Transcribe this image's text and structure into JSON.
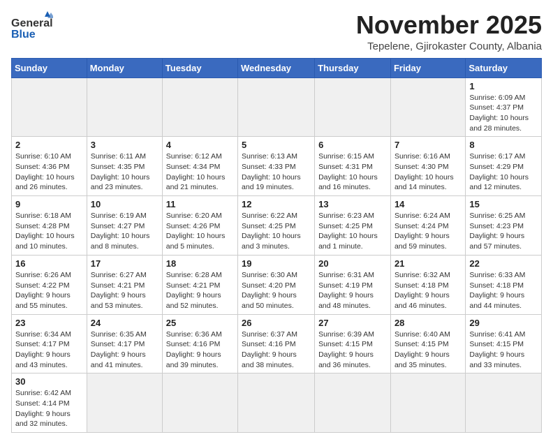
{
  "header": {
    "logo_general": "General",
    "logo_blue": "Blue",
    "title": "November 2025",
    "subtitle": "Tepelene, Gjirokaster County, Albania"
  },
  "days_of_week": [
    "Sunday",
    "Monday",
    "Tuesday",
    "Wednesday",
    "Thursday",
    "Friday",
    "Saturday"
  ],
  "weeks": [
    [
      {
        "day": "",
        "info": "",
        "empty": true
      },
      {
        "day": "",
        "info": "",
        "empty": true
      },
      {
        "day": "",
        "info": "",
        "empty": true
      },
      {
        "day": "",
        "info": "",
        "empty": true
      },
      {
        "day": "",
        "info": "",
        "empty": true
      },
      {
        "day": "",
        "info": "",
        "empty": true
      },
      {
        "day": "1",
        "info": "Sunrise: 6:09 AM\nSunset: 4:37 PM\nDaylight: 10 hours\nand 28 minutes."
      }
    ],
    [
      {
        "day": "2",
        "info": "Sunrise: 6:10 AM\nSunset: 4:36 PM\nDaylight: 10 hours\nand 26 minutes."
      },
      {
        "day": "3",
        "info": "Sunrise: 6:11 AM\nSunset: 4:35 PM\nDaylight: 10 hours\nand 23 minutes."
      },
      {
        "day": "4",
        "info": "Sunrise: 6:12 AM\nSunset: 4:34 PM\nDaylight: 10 hours\nand 21 minutes."
      },
      {
        "day": "5",
        "info": "Sunrise: 6:13 AM\nSunset: 4:33 PM\nDaylight: 10 hours\nand 19 minutes."
      },
      {
        "day": "6",
        "info": "Sunrise: 6:15 AM\nSunset: 4:31 PM\nDaylight: 10 hours\nand 16 minutes."
      },
      {
        "day": "7",
        "info": "Sunrise: 6:16 AM\nSunset: 4:30 PM\nDaylight: 10 hours\nand 14 minutes."
      },
      {
        "day": "8",
        "info": "Sunrise: 6:17 AM\nSunset: 4:29 PM\nDaylight: 10 hours\nand 12 minutes."
      }
    ],
    [
      {
        "day": "9",
        "info": "Sunrise: 6:18 AM\nSunset: 4:28 PM\nDaylight: 10 hours\nand 10 minutes."
      },
      {
        "day": "10",
        "info": "Sunrise: 6:19 AM\nSunset: 4:27 PM\nDaylight: 10 hours\nand 8 minutes."
      },
      {
        "day": "11",
        "info": "Sunrise: 6:20 AM\nSunset: 4:26 PM\nDaylight: 10 hours\nand 5 minutes."
      },
      {
        "day": "12",
        "info": "Sunrise: 6:22 AM\nSunset: 4:25 PM\nDaylight: 10 hours\nand 3 minutes."
      },
      {
        "day": "13",
        "info": "Sunrise: 6:23 AM\nSunset: 4:25 PM\nDaylight: 10 hours\nand 1 minute."
      },
      {
        "day": "14",
        "info": "Sunrise: 6:24 AM\nSunset: 4:24 PM\nDaylight: 9 hours\nand 59 minutes."
      },
      {
        "day": "15",
        "info": "Sunrise: 6:25 AM\nSunset: 4:23 PM\nDaylight: 9 hours\nand 57 minutes."
      }
    ],
    [
      {
        "day": "16",
        "info": "Sunrise: 6:26 AM\nSunset: 4:22 PM\nDaylight: 9 hours\nand 55 minutes."
      },
      {
        "day": "17",
        "info": "Sunrise: 6:27 AM\nSunset: 4:21 PM\nDaylight: 9 hours\nand 53 minutes."
      },
      {
        "day": "18",
        "info": "Sunrise: 6:28 AM\nSunset: 4:21 PM\nDaylight: 9 hours\nand 52 minutes."
      },
      {
        "day": "19",
        "info": "Sunrise: 6:30 AM\nSunset: 4:20 PM\nDaylight: 9 hours\nand 50 minutes."
      },
      {
        "day": "20",
        "info": "Sunrise: 6:31 AM\nSunset: 4:19 PM\nDaylight: 9 hours\nand 48 minutes."
      },
      {
        "day": "21",
        "info": "Sunrise: 6:32 AM\nSunset: 4:18 PM\nDaylight: 9 hours\nand 46 minutes."
      },
      {
        "day": "22",
        "info": "Sunrise: 6:33 AM\nSunset: 4:18 PM\nDaylight: 9 hours\nand 44 minutes."
      }
    ],
    [
      {
        "day": "23",
        "info": "Sunrise: 6:34 AM\nSunset: 4:17 PM\nDaylight: 9 hours\nand 43 minutes."
      },
      {
        "day": "24",
        "info": "Sunrise: 6:35 AM\nSunset: 4:17 PM\nDaylight: 9 hours\nand 41 minutes."
      },
      {
        "day": "25",
        "info": "Sunrise: 6:36 AM\nSunset: 4:16 PM\nDaylight: 9 hours\nand 39 minutes."
      },
      {
        "day": "26",
        "info": "Sunrise: 6:37 AM\nSunset: 4:16 PM\nDaylight: 9 hours\nand 38 minutes."
      },
      {
        "day": "27",
        "info": "Sunrise: 6:39 AM\nSunset: 4:15 PM\nDaylight: 9 hours\nand 36 minutes."
      },
      {
        "day": "28",
        "info": "Sunrise: 6:40 AM\nSunset: 4:15 PM\nDaylight: 9 hours\nand 35 minutes."
      },
      {
        "day": "29",
        "info": "Sunrise: 6:41 AM\nSunset: 4:15 PM\nDaylight: 9 hours\nand 33 minutes."
      }
    ],
    [
      {
        "day": "30",
        "info": "Sunrise: 6:42 AM\nSunset: 4:14 PM\nDaylight: 9 hours\nand 32 minutes."
      },
      {
        "day": "",
        "info": "",
        "empty": true
      },
      {
        "day": "",
        "info": "",
        "empty": true
      },
      {
        "day": "",
        "info": "",
        "empty": true
      },
      {
        "day": "",
        "info": "",
        "empty": true
      },
      {
        "day": "",
        "info": "",
        "empty": true
      },
      {
        "day": "",
        "info": "",
        "empty": true
      }
    ]
  ]
}
